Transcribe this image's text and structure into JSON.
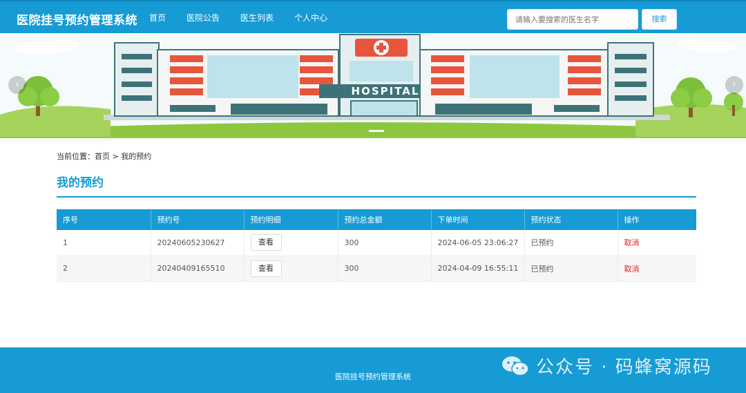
{
  "header": {
    "brand": "医院挂号预约管理系统",
    "nav": [
      "首页",
      "医院公告",
      "医生列表",
      "个人中心"
    ],
    "search_placeholder": "请输入要搜索的医生名字",
    "search_button": "搜索"
  },
  "banner": {
    "sign_text": "HOSPITAL",
    "prev_arrow": "‹",
    "next_arrow": "›"
  },
  "breadcrumb": {
    "prefix": "当前位置：",
    "home": "首页",
    "separator": " > ",
    "current": "我的预约"
  },
  "page_title": "我的预约",
  "table": {
    "headers": [
      "序号",
      "预约号",
      "预约明细",
      "预约总金额",
      "下单时间",
      "预约状态",
      "操作"
    ],
    "rows": [
      {
        "index": "1",
        "order_no": "20240605230627",
        "detail_button": "查看",
        "amount": "300",
        "time": "2024-06-05 23:06:27",
        "status": "已预约",
        "action": "取消"
      },
      {
        "index": "2",
        "order_no": "20240409165510",
        "detail_button": "查看",
        "amount": "300",
        "time": "2024-04-09 16:55:11",
        "status": "已预约",
        "action": "取消"
      }
    ]
  },
  "footer": {
    "text": "医院挂号预约管理系统",
    "watermark": "公众号 · 码蜂窝源码"
  },
  "colors": {
    "primary": "#169bd5",
    "danger": "#e02020",
    "hospital_red": "#e8553d",
    "hospital_teal": "#3d7378"
  }
}
